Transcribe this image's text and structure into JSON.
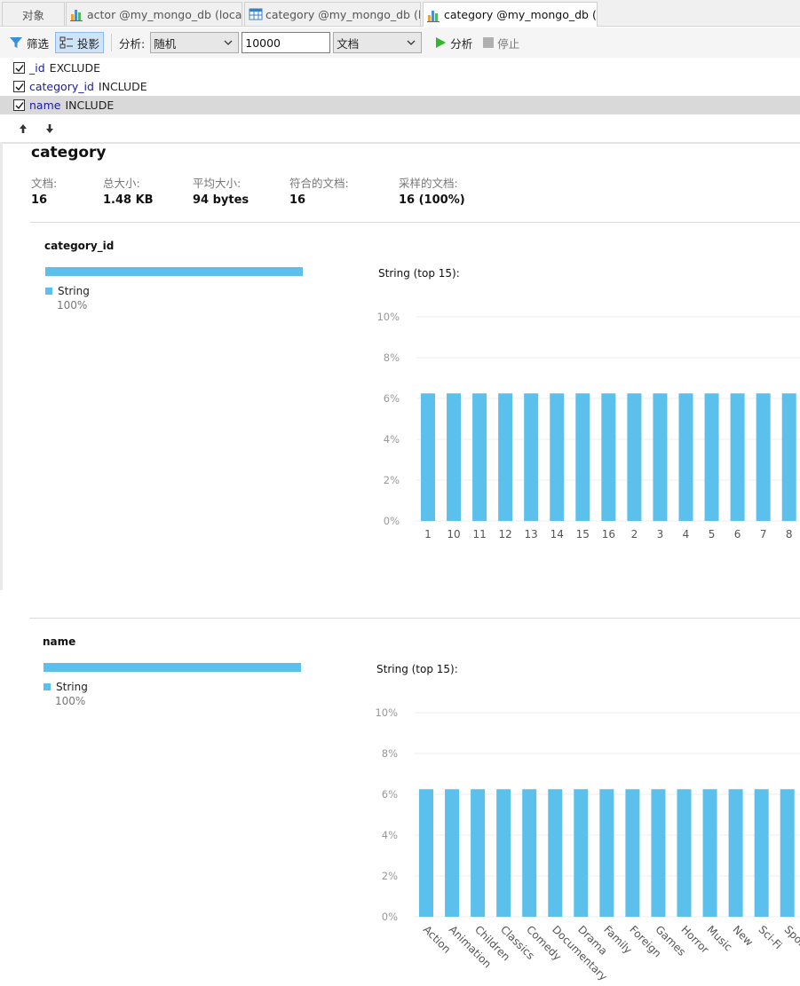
{
  "tabs": [
    {
      "label": "对象",
      "icon": ""
    },
    {
      "label": "actor @my_mongo_db (local)",
      "icon": "bar-chart-icon"
    },
    {
      "label": "category @my_mongo_db (local)",
      "icon": "table-grid-icon"
    },
    {
      "label": "category @my_mongo_db (local)",
      "icon": "bar-chart-icon",
      "active": true
    }
  ],
  "toolbar": {
    "filter_label": "筛选",
    "projection_label": "投影",
    "analyze_prefix": "分析:",
    "mode_value": "随机",
    "limit_value": "10000",
    "unit_value": "文档",
    "analyze_label": "分析",
    "stop_label": "停止"
  },
  "projection": [
    {
      "field": "_id",
      "mode": "EXCLUDE",
      "checked": true
    },
    {
      "field": "category_id",
      "mode": "INCLUDE",
      "checked": true
    },
    {
      "field": "name",
      "mode": "INCLUDE",
      "checked": true,
      "selected": true
    }
  ],
  "report": {
    "collection": "category",
    "stats": [
      {
        "label": "文档:",
        "value": "16"
      },
      {
        "label": "总大小:",
        "value": "1.48 KB"
      },
      {
        "label": "平均大小:",
        "value": "94 bytes"
      },
      {
        "label": "符合的文档:",
        "value": "16"
      },
      {
        "label": "采样的文档:",
        "value": "16 (100%)"
      }
    ],
    "fields": [
      {
        "name": "category_id",
        "type": "String",
        "type_pct": "100%",
        "type_fraction": 1.0,
        "chart_title": "String (top 15):"
      },
      {
        "name": "name",
        "type": "String",
        "type_pct": "100%",
        "type_fraction": 1.0,
        "chart_title": "String (top 15):"
      }
    ]
  },
  "colors": {
    "bar": "#5bc0eb",
    "accent": "#1a1aa6"
  },
  "chart_data": [
    {
      "type": "bar",
      "title": "String (top 15):",
      "categories": [
        "1",
        "10",
        "11",
        "12",
        "13",
        "14",
        "15",
        "16",
        "2",
        "3",
        "4",
        "5",
        "6",
        "7",
        "8"
      ],
      "values": [
        6.25,
        6.25,
        6.25,
        6.25,
        6.25,
        6.25,
        6.25,
        6.25,
        6.25,
        6.25,
        6.25,
        6.25,
        6.25,
        6.25,
        6.25
      ],
      "yticks": [
        "0%",
        "2%",
        "4%",
        "6%",
        "8%",
        "10%"
      ],
      "ylim": [
        0,
        10
      ],
      "grid": true
    },
    {
      "type": "bar",
      "title": "String (top 15):",
      "categories": [
        "Action",
        "Animation",
        "Children",
        "Classics",
        "Comedy",
        "Documentary",
        "Drama",
        "Family",
        "Foreign",
        "Games",
        "Horror",
        "Music",
        "New",
        "Sci-Fi",
        "Sports"
      ],
      "values": [
        6.25,
        6.25,
        6.25,
        6.25,
        6.25,
        6.25,
        6.25,
        6.25,
        6.25,
        6.25,
        6.25,
        6.25,
        6.25,
        6.25,
        6.25
      ],
      "yticks": [
        "0%",
        "2%",
        "4%",
        "6%",
        "8%",
        "10%"
      ],
      "ylim": [
        0,
        10
      ],
      "grid": true
    }
  ]
}
